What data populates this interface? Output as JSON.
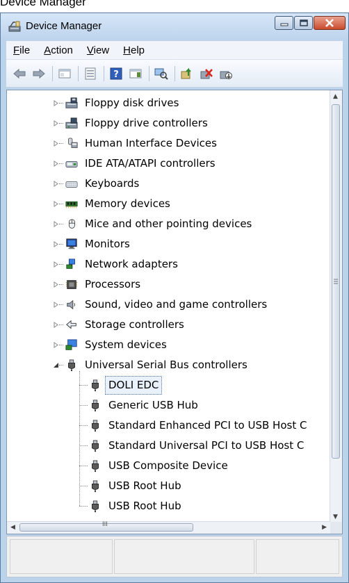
{
  "caption": "Device Manager",
  "window": {
    "title": "Device Manager",
    "controls": {
      "minimize": "minimize-icon",
      "maximize": "maximize-icon",
      "close": "close-icon"
    }
  },
  "menu": [
    {
      "label": "File",
      "accel": "F",
      "rest": "ile"
    },
    {
      "label": "Action",
      "accel": "A",
      "rest": "ction"
    },
    {
      "label": "View",
      "accel": "V",
      "rest": "iew"
    },
    {
      "label": "Help",
      "accel": "H",
      "rest": "elp"
    }
  ],
  "toolbar": [
    "back-icon",
    "forward-icon",
    "show-hide-console-tree-icon",
    "properties-icon",
    "help-icon",
    "show-action-pane-icon",
    "scan-hardware-icon",
    "update-driver-icon",
    "uninstall-icon",
    "disable-device-icon"
  ],
  "tree": {
    "categories": [
      {
        "label": "Floppy disk drives",
        "icon": "floppy-disk-icon"
      },
      {
        "label": "Floppy drive controllers",
        "icon": "floppy-controller-icon"
      },
      {
        "label": "Human Interface Devices",
        "icon": "hid-icon"
      },
      {
        "label": "IDE ATA/ATAPI controllers",
        "icon": "ide-controller-icon"
      },
      {
        "label": "Keyboards",
        "icon": "keyboard-icon"
      },
      {
        "label": "Memory devices",
        "icon": "memory-icon"
      },
      {
        "label": "Mice and other pointing devices",
        "icon": "mouse-icon"
      },
      {
        "label": "Monitors",
        "icon": "monitor-icon"
      },
      {
        "label": "Network adapters",
        "icon": "network-adapter-icon"
      },
      {
        "label": "Processors",
        "icon": "processor-icon"
      },
      {
        "label": "Sound, video and game controllers",
        "icon": "speaker-icon"
      },
      {
        "label": "Storage controllers",
        "icon": "storage-controller-icon"
      },
      {
        "label": "System devices",
        "icon": "system-devices-icon"
      },
      {
        "label": "Universal Serial Bus controllers",
        "icon": "usb-icon"
      }
    ],
    "usb_children": [
      {
        "label": "DOLI EDC",
        "selected": true
      },
      {
        "label": "Generic USB Hub"
      },
      {
        "label": "Standard Enhanced PCI to USB Host C"
      },
      {
        "label": "Standard Universal PCI to USB Host C"
      },
      {
        "label": "USB Composite Device"
      },
      {
        "label": "USB Root Hub"
      },
      {
        "label": "USB Root Hub"
      }
    ],
    "hscroll_grip": "III"
  }
}
